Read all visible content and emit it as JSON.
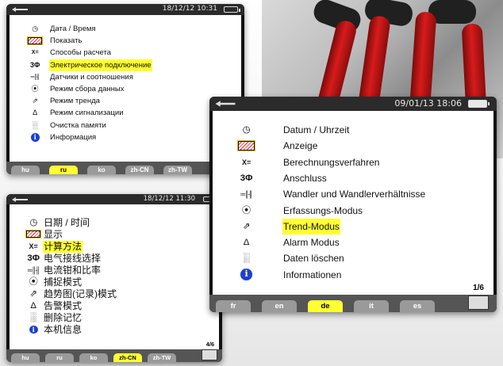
{
  "screen_ru": {
    "datetime": "18/12/12 10:31",
    "items": [
      {
        "icon": "clock-icon",
        "glyph": "◷",
        "label": "Дата / Время"
      },
      {
        "icon": "display-icon",
        "glyph": "",
        "label": "Показать"
      },
      {
        "icon": "calc-methods-icon",
        "glyph": "X=",
        "label": "Способы расчета"
      },
      {
        "icon": "three-phase-icon",
        "glyph": "3Φ",
        "label": "Электрическое подключение",
        "highlight": true
      },
      {
        "icon": "clamp-sensor-icon",
        "glyph": "═║╢",
        "label": "Датчики и соотношения"
      },
      {
        "icon": "capture-mode-icon",
        "glyph": "⦿",
        "label": "Режим сбора данных"
      },
      {
        "icon": "trend-icon",
        "glyph": "⇗",
        "label": "Режим тренда"
      },
      {
        "icon": "alarm-icon",
        "glyph": "Δ",
        "label": "Режим сигнализации"
      },
      {
        "icon": "trash-icon",
        "glyph": "░",
        "label": "Очистка памяти"
      },
      {
        "icon": "info-icon",
        "glyph": "i",
        "label": "Информация"
      }
    ],
    "tabs": [
      "hu",
      "ru",
      "ko",
      "zh-CN",
      "zh-TW"
    ],
    "selected_tab": "ru"
  },
  "screen_zh": {
    "datetime": "18/12/12 11:30",
    "items": [
      {
        "icon": "clock-icon",
        "glyph": "◷",
        "label": "日期 / 时间"
      },
      {
        "icon": "display-icon",
        "glyph": "",
        "label": "显示"
      },
      {
        "icon": "calc-methods-icon",
        "glyph": "X=",
        "label": "计算方法",
        "highlight": true
      },
      {
        "icon": "three-phase-icon",
        "glyph": "3Φ",
        "label": "电气接线选择"
      },
      {
        "icon": "clamp-sensor-icon",
        "glyph": "═║╢",
        "label": "电流钳和比率"
      },
      {
        "icon": "capture-mode-icon",
        "glyph": "⦿",
        "label": "捕捉模式"
      },
      {
        "icon": "trend-icon",
        "glyph": "⇗",
        "label": "趋势图(记录)模式"
      },
      {
        "icon": "alarm-icon",
        "glyph": "Δ",
        "label": "告警模式"
      },
      {
        "icon": "trash-icon",
        "glyph": "░",
        "label": "删除记忆"
      },
      {
        "icon": "info-icon",
        "glyph": "i",
        "label": "本机信息"
      }
    ],
    "tabs": [
      "hu",
      "ru",
      "ko",
      "zh-CN",
      "zh-TW"
    ],
    "selected_tab": "zh-CN",
    "page": "4/6"
  },
  "screen_de": {
    "datetime": "09/01/13 18:06",
    "items": [
      {
        "icon": "clock-icon",
        "glyph": "◷",
        "label": "Datum / Uhrzeit"
      },
      {
        "icon": "display-icon",
        "glyph": "",
        "label": "Anzeige"
      },
      {
        "icon": "calc-methods-icon",
        "glyph": "X=",
        "label": "Berechnungsverfahren"
      },
      {
        "icon": "three-phase-icon",
        "glyph": "3Φ",
        "label": "Anschluss"
      },
      {
        "icon": "clamp-sensor-icon",
        "glyph": "═║╢",
        "label": "Wandler und Wandlerverhältnisse"
      },
      {
        "icon": "capture-mode-icon",
        "glyph": "⦿",
        "label": "Erfassungs-Modus"
      },
      {
        "icon": "trend-icon",
        "glyph": "⇗",
        "label": "Trend-Modus",
        "highlight": true
      },
      {
        "icon": "alarm-icon",
        "glyph": "Δ",
        "label": "Alarm Modus"
      },
      {
        "icon": "trash-icon",
        "glyph": "░",
        "label": "Daten löschen"
      },
      {
        "icon": "info-icon",
        "glyph": "i",
        "label": "Informationen"
      }
    ],
    "tabs": [
      "fr",
      "en",
      "de",
      "it",
      "es"
    ],
    "selected_tab": "de",
    "page": "1/6"
  },
  "colors": {
    "highlight": "#ffff33",
    "info_blue": "#1d3fcf",
    "tab_gray": "#9a9a9a",
    "bar_dark": "#2b2b2b"
  }
}
